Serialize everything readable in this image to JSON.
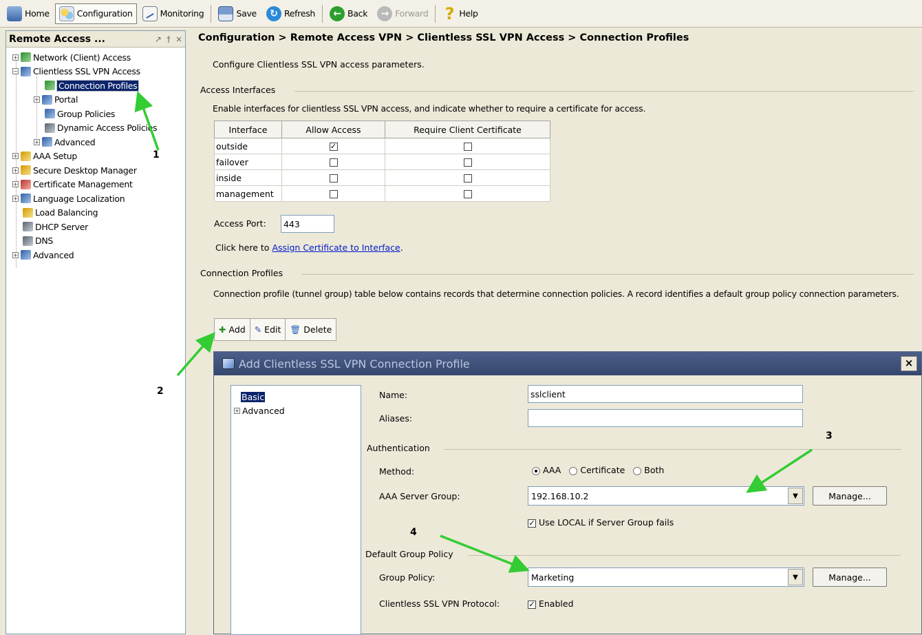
{
  "toolbar": {
    "home": "Home",
    "configuration": "Configuration",
    "monitoring": "Monitoring",
    "save": "Save",
    "refresh": "Refresh",
    "back": "Back",
    "forward": "Forward",
    "help": "Help"
  },
  "left_panel": {
    "title": "Remote Access ...",
    "header_controls": [
      "↗",
      "†",
      "×"
    ],
    "tree": {
      "network_client_access": "Network (Client) Access",
      "clientless_ssl_vpn_access": "Clientless SSL VPN Access",
      "connection_profiles": "Connection Profiles",
      "portal": "Portal",
      "group_policies": "Group Policies",
      "dynamic_access_policies": "Dynamic Access Policies",
      "advanced_sub": "Advanced",
      "aaa_setup": "AAA Setup",
      "secure_desktop_manager": "Secure Desktop Manager",
      "certificate_management": "Certificate Management",
      "language_localization": "Language Localization",
      "load_balancing": "Load Balancing",
      "dhcp_server": "DHCP Server",
      "dns": "DNS",
      "advanced": "Advanced"
    }
  },
  "main": {
    "breadcrumb": "Configuration > Remote Access VPN > Clientless SSL VPN Access > Connection Profiles",
    "description": "Configure Clientless SSL VPN access parameters.",
    "access_interfaces": {
      "title": "Access Interfaces",
      "description": "Enable interfaces for clientless SSL VPN access, and indicate whether to require a certificate for access.",
      "columns": [
        "Interface",
        "Allow Access",
        "Require Client Certificate"
      ],
      "rows": [
        {
          "interface": "outside",
          "allow": true,
          "require_cert": false
        },
        {
          "interface": "failover",
          "allow": false,
          "require_cert": false
        },
        {
          "interface": "inside",
          "allow": false,
          "require_cert": false
        },
        {
          "interface": "management",
          "allow": false,
          "require_cert": false
        }
      ]
    },
    "access_port_label": "Access Port:",
    "access_port_value": "443",
    "assign_prefix": "Click here to",
    "assign_link": "Assign Certificate to Interface",
    "assign_suffix": ".",
    "connection_profiles": {
      "title": "Connection Profiles",
      "description": "Connection profile (tunnel group) table below contains records that determine connection policies. A record identifies a default group policy connection parameters.",
      "add": "Add",
      "edit": "Edit",
      "delete": "Delete"
    }
  },
  "dialog": {
    "title": "Add Clientless SSL VPN Connection Profile",
    "close": "×",
    "nav": {
      "basic": "Basic",
      "advanced": "Advanced"
    },
    "name_label": "Name:",
    "name_value": "sslclient",
    "aliases_label": "Aliases:",
    "aliases_value": "",
    "authentication": "Authentication",
    "method_label": "Method:",
    "methods": [
      "AAA",
      "Certificate",
      "Both"
    ],
    "method_selected": "AAA",
    "aaa_server_group_label": "AAA Server Group:",
    "aaa_server_group_value": "192.168.10.2",
    "manage": "Manage...",
    "use_local_label": "Use LOCAL if Server Group fails",
    "use_local_checked": true,
    "default_group_policy": "Default Group Policy",
    "group_policy_label": "Group Policy:",
    "group_policy_value": "Marketing",
    "clientless_protocol_label": "Clientless SSL VPN Protocol:",
    "clientless_protocol_value": "Enabled",
    "clientless_protocol_checked": true
  },
  "annotations": [
    "1",
    "2",
    "3",
    "4"
  ],
  "colors": {
    "arrow": "#33cc33",
    "selection": "#0b246b",
    "link": "#0019c8"
  }
}
